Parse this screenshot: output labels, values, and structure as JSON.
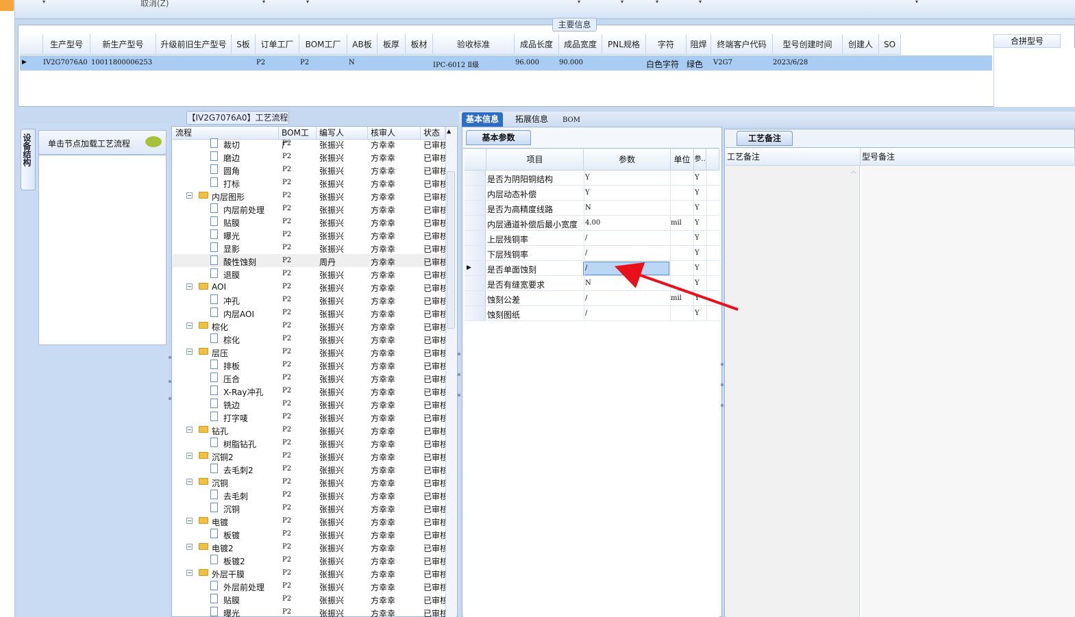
{
  "top_toolbar": {
    "cancel_label": "取消(Z)"
  },
  "main_info": {
    "title": "主要信息",
    "columns": [
      "生产型号",
      "新生产型号",
      "升级前旧生产型号",
      "S板",
      "订单工厂",
      "BOM工厂",
      "AB板",
      "板厚",
      "板材",
      "验收标准",
      "成品长度",
      "成品宽度",
      "PNL规格",
      "字符",
      "阻焊",
      "终端客户代码",
      "型号创建时间",
      "创建人",
      "SO"
    ],
    "row": {
      "model": "IV2G7076A0",
      "new_model": "10011800006253",
      "order_factory": "P2",
      "bom_factory": "P2",
      "ab": "N",
      "standard": "IPC-6012 Ⅱ级",
      "length": "96.000",
      "width": "90.000",
      "char": "白色字符",
      "mask": "绿色",
      "customer": "V2G7",
      "created": "2023/6/28"
    },
    "merge_header": "合拼型号"
  },
  "left_panel": {
    "vertical_tab": "设备结构",
    "click_text": "单击节点加载工艺流程"
  },
  "process": {
    "title": "【IV2G7076A0】工艺流程",
    "headers": [
      "流程",
      "BOM工厂",
      "编写人",
      "核审人",
      "状态"
    ],
    "rows": [
      {
        "n": "裁切",
        "f": "P2",
        "w": "张振兴",
        "r": "方幸幸",
        "s": "已审核",
        "lvl": 2
      },
      {
        "n": "磨边",
        "f": "P2",
        "w": "张振兴",
        "r": "方幸幸",
        "s": "已审核",
        "lvl": 2
      },
      {
        "n": "圆角",
        "f": "P2",
        "w": "张振兴",
        "r": "方幸幸",
        "s": "已审核",
        "lvl": 2
      },
      {
        "n": "打标",
        "f": "P2",
        "w": "张振兴",
        "r": "方幸幸",
        "s": "已审核",
        "lvl": 2
      },
      {
        "n": "内层图形",
        "f": "P2",
        "w": "张振兴",
        "r": "方幸幸",
        "s": "已审核",
        "lvl": 1
      },
      {
        "n": "内层前处理",
        "f": "P2",
        "w": "张振兴",
        "r": "方幸幸",
        "s": "已审核",
        "lvl": 2
      },
      {
        "n": "贴膜",
        "f": "P2",
        "w": "张振兴",
        "r": "方幸幸",
        "s": "已审核",
        "lvl": 2
      },
      {
        "n": "曝光",
        "f": "P2",
        "w": "张振兴",
        "r": "方幸幸",
        "s": "已审核",
        "lvl": 2
      },
      {
        "n": "显影",
        "f": "P2",
        "w": "张振兴",
        "r": "方幸幸",
        "s": "已审核",
        "lvl": 2
      },
      {
        "n": "酸性蚀刻",
        "f": "P2",
        "w": "周丹",
        "r": "方幸幸",
        "s": "已审核",
        "lvl": 2,
        "sel": true
      },
      {
        "n": "退膜",
        "f": "P2",
        "w": "张振兴",
        "r": "方幸幸",
        "s": "已审核",
        "lvl": 2
      },
      {
        "n": "AOI",
        "f": "P2",
        "w": "张振兴",
        "r": "方幸幸",
        "s": "已审核",
        "lvl": 1
      },
      {
        "n": "冲孔",
        "f": "P2",
        "w": "张振兴",
        "r": "方幸幸",
        "s": "已审核",
        "lvl": 2
      },
      {
        "n": "内层AOI",
        "f": "P2",
        "w": "张振兴",
        "r": "方幸幸",
        "s": "已审核",
        "lvl": 2
      },
      {
        "n": "棕化",
        "f": "P2",
        "w": "张振兴",
        "r": "方幸幸",
        "s": "已审核",
        "lvl": 1
      },
      {
        "n": "棕化",
        "f": "P2",
        "w": "张振兴",
        "r": "方幸幸",
        "s": "已审核",
        "lvl": 2
      },
      {
        "n": "层压",
        "f": "P2",
        "w": "张振兴",
        "r": "方幸幸",
        "s": "已审核",
        "lvl": 1
      },
      {
        "n": "排板",
        "f": "P2",
        "w": "张振兴",
        "r": "方幸幸",
        "s": "已审核",
        "lvl": 2
      },
      {
        "n": "压合",
        "f": "P2",
        "w": "张振兴",
        "r": "方幸幸",
        "s": "已审核",
        "lvl": 2
      },
      {
        "n": "X-Ray冲孔",
        "f": "P2",
        "w": "张振兴",
        "r": "方幸幸",
        "s": "已审核",
        "lvl": 2
      },
      {
        "n": "铣边",
        "f": "P2",
        "w": "张振兴",
        "r": "方幸幸",
        "s": "已审核",
        "lvl": 2
      },
      {
        "n": "打字唛",
        "f": "P2",
        "w": "张振兴",
        "r": "方幸幸",
        "s": "已审核",
        "lvl": 2
      },
      {
        "n": "钻孔",
        "f": "P2",
        "w": "张振兴",
        "r": "方幸幸",
        "s": "已审核",
        "lvl": 1
      },
      {
        "n": "树脂钻孔",
        "f": "P2",
        "w": "张振兴",
        "r": "方幸幸",
        "s": "已审核",
        "lvl": 2
      },
      {
        "n": "沉铜2",
        "f": "P2",
        "w": "张振兴",
        "r": "方幸幸",
        "s": "已审核",
        "lvl": 1
      },
      {
        "n": "去毛刺2",
        "f": "P2",
        "w": "张振兴",
        "r": "方幸幸",
        "s": "已审核",
        "lvl": 2
      },
      {
        "n": "沉铜",
        "f": "P2",
        "w": "张振兴",
        "r": "方幸幸",
        "s": "已审核",
        "lvl": 1
      },
      {
        "n": "去毛刺",
        "f": "P2",
        "w": "张振兴",
        "r": "方幸幸",
        "s": "已审核",
        "lvl": 2
      },
      {
        "n": "沉铜",
        "f": "P2",
        "w": "张振兴",
        "r": "方幸幸",
        "s": "已审核",
        "lvl": 2
      },
      {
        "n": "电镀",
        "f": "P2",
        "w": "张振兴",
        "r": "方幸幸",
        "s": "已审核",
        "lvl": 1
      },
      {
        "n": "板镀",
        "f": "P2",
        "w": "张振兴",
        "r": "方幸幸",
        "s": "已审核",
        "lvl": 2
      },
      {
        "n": "电镀2",
        "f": "P2",
        "w": "张振兴",
        "r": "方幸幸",
        "s": "已审核",
        "lvl": 1
      },
      {
        "n": "板镀2",
        "f": "P2",
        "w": "张振兴",
        "r": "方幸幸",
        "s": "已审核",
        "lvl": 2
      },
      {
        "n": "外层干膜",
        "f": "P2",
        "w": "张振兴",
        "r": "方幸幸",
        "s": "已审核",
        "lvl": 1
      },
      {
        "n": "外层前处理",
        "f": "P2",
        "w": "张振兴",
        "r": "方幸幸",
        "s": "已审核",
        "lvl": 2
      },
      {
        "n": "贴膜",
        "f": "P2",
        "w": "张振兴",
        "r": "方幸幸",
        "s": "已审核",
        "lvl": 2
      },
      {
        "n": "曝光",
        "f": "P2",
        "w": "张振兴",
        "r": "方幸幸",
        "s": "已审核",
        "lvl": 2
      }
    ]
  },
  "tabs": [
    "基本信息",
    "拓展信息",
    "BOM"
  ],
  "basic_params": {
    "tab": "基本参数",
    "headers": [
      "项目",
      "参数",
      "单位",
      "参.."
    ],
    "rows": [
      {
        "item": "是否为阴阳铜结构",
        "param": "Y",
        "unit": "",
        "flag": "Y"
      },
      {
        "item": "内层动态补偿",
        "param": "Y",
        "unit": "",
        "flag": "Y"
      },
      {
        "item": "是否为高精度线路",
        "param": "N",
        "unit": "",
        "flag": "Y"
      },
      {
        "item": "内层通道补偿后最小宽度",
        "param": "4.00",
        "unit": "mil",
        "flag": "Y"
      },
      {
        "item": "上层残铜率",
        "param": "/",
        "unit": "",
        "flag": "Y"
      },
      {
        "item": "下层残铜率",
        "param": "/",
        "unit": "",
        "flag": "Y"
      },
      {
        "item": "是否单面蚀刻",
        "param": "/",
        "unit": "",
        "flag": "Y",
        "sel": true
      },
      {
        "item": "是否有缝宽要求",
        "param": "N",
        "unit": "",
        "flag": "Y"
      },
      {
        "item": "蚀刻公差",
        "param": "/",
        "unit": "mil",
        "flag": "Y"
      },
      {
        "item": "蚀刻图纸",
        "param": "/",
        "unit": "",
        "flag": "Y"
      }
    ]
  },
  "remarks": {
    "tab": "工艺备注",
    "col1": "工艺备注",
    "col2": "型号备注"
  },
  "colors": {
    "accent": "#2f6dc4",
    "selection": "#a9cdf2",
    "arrow": "#e8101a"
  }
}
